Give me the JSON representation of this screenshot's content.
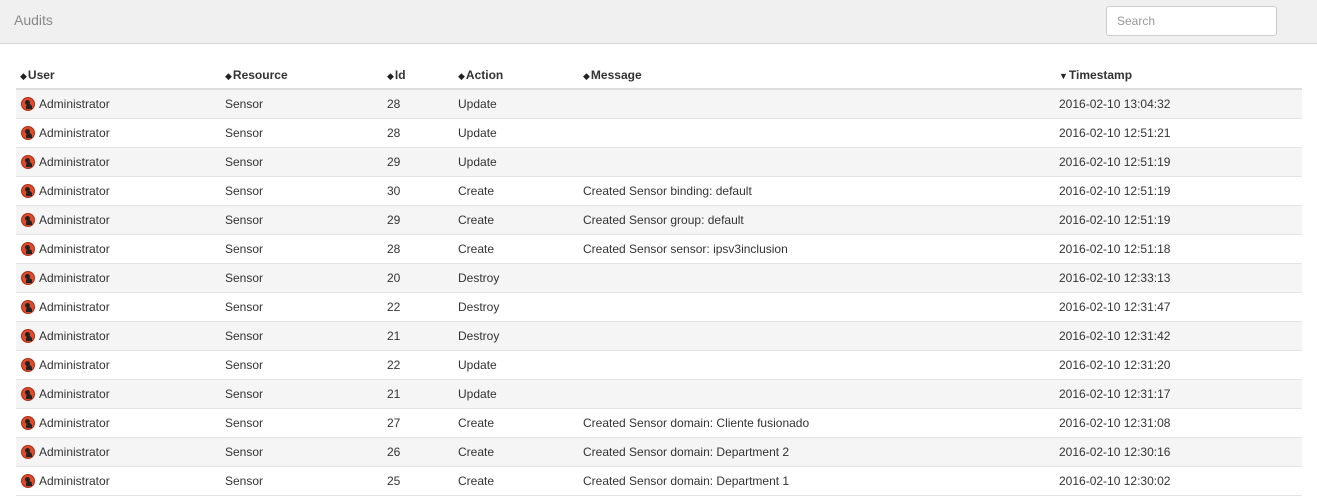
{
  "header": {
    "title": "Audits",
    "search_placeholder": "Search"
  },
  "columns": [
    {
      "label": "User",
      "sort": "both"
    },
    {
      "label": "Resource",
      "sort": "both"
    },
    {
      "label": "Id",
      "sort": "both"
    },
    {
      "label": "Action",
      "sort": "both"
    },
    {
      "label": "Message",
      "sort": "both"
    },
    {
      "label": "Timestamp",
      "sort": "desc"
    }
  ],
  "rows": [
    {
      "user": "Administrator",
      "resource": "Sensor",
      "id": "28",
      "action": "Update",
      "message": "",
      "timestamp": "2016-02-10 13:04:32"
    },
    {
      "user": "Administrator",
      "resource": "Sensor",
      "id": "28",
      "action": "Update",
      "message": "",
      "timestamp": "2016-02-10 12:51:21"
    },
    {
      "user": "Administrator",
      "resource": "Sensor",
      "id": "29",
      "action": "Update",
      "message": "",
      "timestamp": "2016-02-10 12:51:19"
    },
    {
      "user": "Administrator",
      "resource": "Sensor",
      "id": "30",
      "action": "Create",
      "message": "Created Sensor binding: default",
      "timestamp": "2016-02-10 12:51:19"
    },
    {
      "user": "Administrator",
      "resource": "Sensor",
      "id": "29",
      "action": "Create",
      "message": "Created Sensor group: default",
      "timestamp": "2016-02-10 12:51:19"
    },
    {
      "user": "Administrator",
      "resource": "Sensor",
      "id": "28",
      "action": "Create",
      "message": "Created Sensor sensor: ipsv3inclusion",
      "timestamp": "2016-02-10 12:51:18"
    },
    {
      "user": "Administrator",
      "resource": "Sensor",
      "id": "20",
      "action": "Destroy",
      "message": "",
      "timestamp": "2016-02-10 12:33:13"
    },
    {
      "user": "Administrator",
      "resource": "Sensor",
      "id": "22",
      "action": "Destroy",
      "message": "",
      "timestamp": "2016-02-10 12:31:47"
    },
    {
      "user": "Administrator",
      "resource": "Sensor",
      "id": "21",
      "action": "Destroy",
      "message": "",
      "timestamp": "2016-02-10 12:31:42"
    },
    {
      "user": "Administrator",
      "resource": "Sensor",
      "id": "22",
      "action": "Update",
      "message": "",
      "timestamp": "2016-02-10 12:31:20"
    },
    {
      "user": "Administrator",
      "resource": "Sensor",
      "id": "21",
      "action": "Update",
      "message": "",
      "timestamp": "2016-02-10 12:31:17"
    },
    {
      "user": "Administrator",
      "resource": "Sensor",
      "id": "27",
      "action": "Create",
      "message": "Created Sensor domain: Cliente fusionado",
      "timestamp": "2016-02-10 12:31:08"
    },
    {
      "user": "Administrator",
      "resource": "Sensor",
      "id": "26",
      "action": "Create",
      "message": "Created Sensor domain: Department 2",
      "timestamp": "2016-02-10 12:30:16"
    },
    {
      "user": "Administrator",
      "resource": "Sensor",
      "id": "25",
      "action": "Create",
      "message": "Created Sensor domain: Department 1",
      "timestamp": "2016-02-10 12:30:02"
    }
  ],
  "icons": {
    "user_icon": "user-avatar-icon",
    "sort_both": "sort-icon",
    "sort_desc": "sort-desc-icon"
  },
  "colors": {
    "user_icon": "#e04a2a",
    "header_bar": "#f0f0f0",
    "row_stripe": "#f5f5f5"
  }
}
